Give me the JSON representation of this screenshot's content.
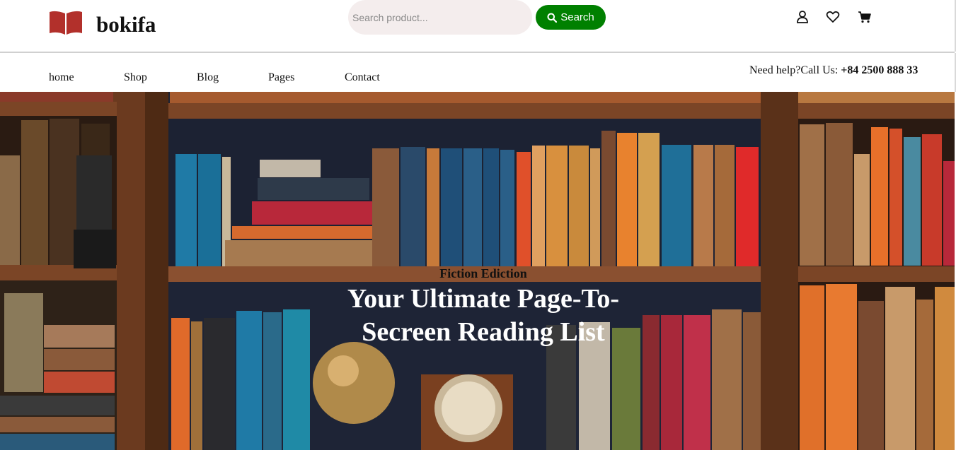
{
  "header": {
    "brand": "bokifa",
    "search": {
      "placeholder": "Search product...",
      "value": "",
      "button_label": "Search"
    },
    "icons": [
      "user-icon",
      "heart-icon",
      "cart-icon"
    ]
  },
  "nav": {
    "items": [
      {
        "label": "home"
      },
      {
        "label": "Shop"
      },
      {
        "label": "Blog"
      },
      {
        "label": "Pages"
      },
      {
        "label": "Contact"
      }
    ],
    "help": {
      "prefix": "Need help?Call Us: ",
      "phone": "+84 2500 888 33"
    }
  },
  "hero": {
    "subtitle": "Fiction Ediction",
    "title": "Your Ultimate Page-To-Secreen Reading List"
  },
  "colors": {
    "accent_green": "#008000",
    "logo_red": "#b2302b",
    "search_bg": "#f4eded"
  }
}
